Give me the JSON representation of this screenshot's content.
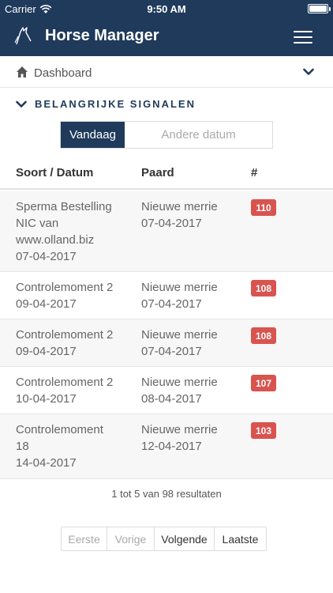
{
  "status_bar": {
    "carrier": "Carrier",
    "time": "9:50 AM"
  },
  "header": {
    "title": "Horse Manager"
  },
  "breadcrumb": {
    "label": "Dashboard"
  },
  "section": {
    "title": "BELANGRIJKE SIGNALEN"
  },
  "filter": {
    "active": "Vandaag",
    "inactive": "Andere datum"
  },
  "table": {
    "columns": [
      "Soort / Datum",
      "Paard",
      "#"
    ],
    "rows": [
      {
        "soort": "Sperma Bestelling\nNIC van\nwww.olland.biz\n07-04-2017",
        "paard": "Nieuwe merrie\n07-04-2017",
        "count": "110"
      },
      {
        "soort": "Controlemoment 2\n09-04-2017",
        "paard": "Nieuwe merrie\n07-04-2017",
        "count": "108"
      },
      {
        "soort": "Controlemoment 2\n09-04-2017",
        "paard": "Nieuwe merrie\n07-04-2017",
        "count": "108"
      },
      {
        "soort": "Controlemoment 2\n10-04-2017",
        "paard": "Nieuwe merrie\n08-04-2017",
        "count": "107"
      },
      {
        "soort": "Controlemoment\n18\n14-04-2017",
        "paard": "Nieuwe merrie\n12-04-2017",
        "count": "103"
      }
    ]
  },
  "results": "1 tot 5 van 98 resultaten",
  "pagination": {
    "first": "Eerste",
    "prev": "Vorige",
    "next": "Volgende",
    "last": "Laatste"
  },
  "colors": {
    "navy": "#1f3a5b",
    "badge": "#d9534f"
  }
}
